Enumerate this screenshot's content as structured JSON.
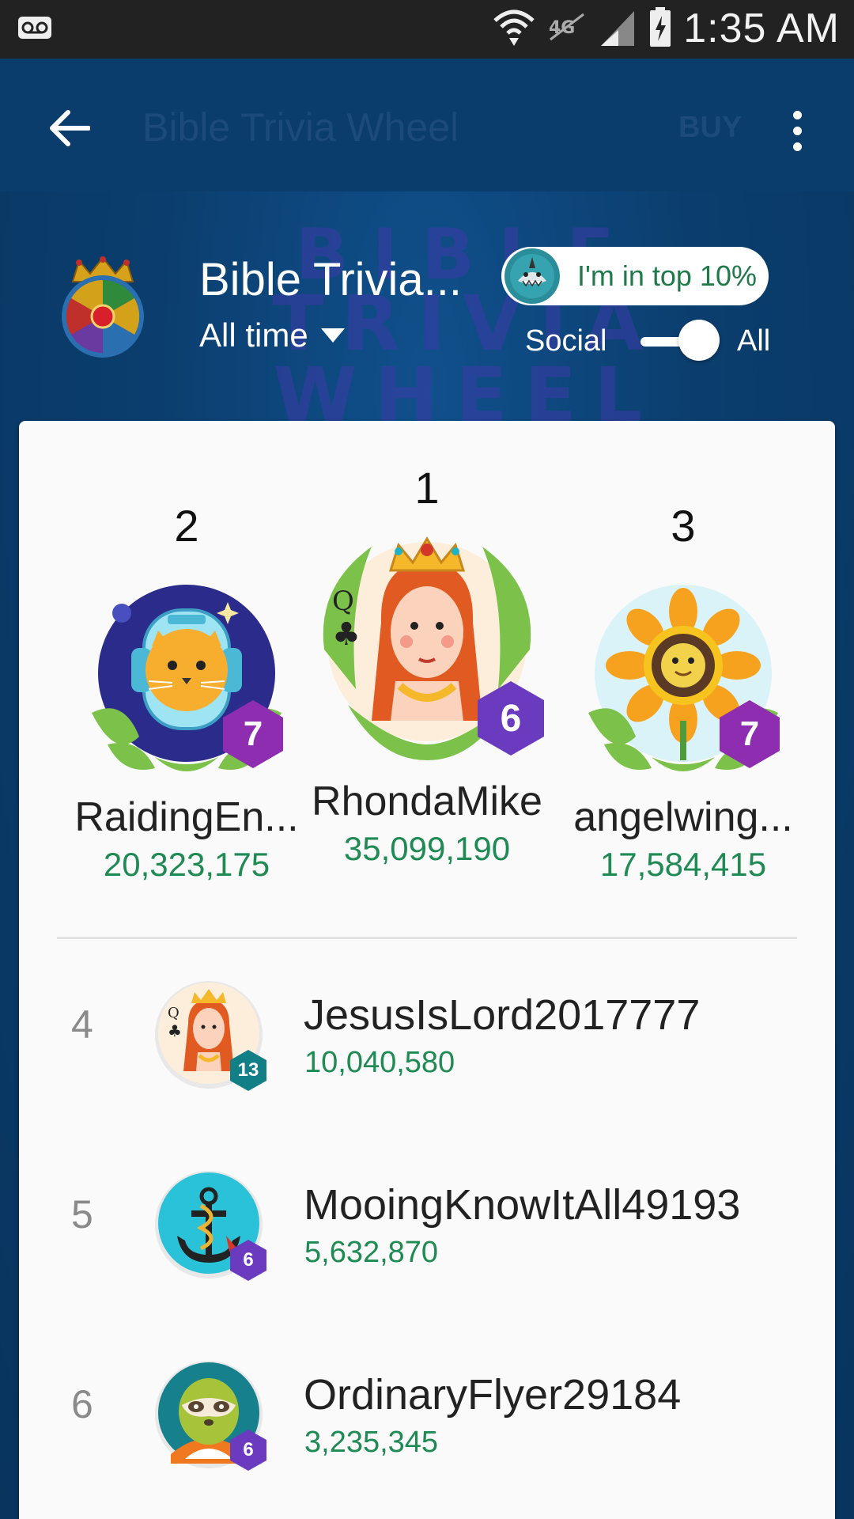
{
  "status_bar": {
    "time": "1:35 AM"
  },
  "app_bar": {
    "title": "Bible Trivia Wheel",
    "buy_label": "BUY"
  },
  "banner": {
    "bg_line1": "BIBLE",
    "bg_line2": "TRIVIA WHEEL",
    "game_name": "Bible Trivia...",
    "period": "All time",
    "badge_text": "I'm in top 10%",
    "toggle_left": "Social",
    "toggle_right": "All",
    "toggle_selected": "All"
  },
  "podium": [
    {
      "rank": "2",
      "name": "RaidingEn...",
      "score": "20,323,175",
      "level": "7",
      "avatar": "astronaut-cat",
      "level_color": "#8e2db0"
    },
    {
      "rank": "1",
      "name": "RhondaMike",
      "score": "35,099,190",
      "level": "6",
      "avatar": "queen-of-clubs",
      "level_color": "#6a3bbf"
    },
    {
      "rank": "3",
      "name": "angelwing...",
      "score": "17,584,415",
      "level": "7",
      "avatar": "sunflower",
      "level_color": "#8e2db0"
    }
  ],
  "list": [
    {
      "rank": "4",
      "name": "JesusIsLord2017777",
      "score": "10,040,580",
      "level": "13",
      "avatar": "queen-of-clubs",
      "level_color": "#127f86"
    },
    {
      "rank": "5",
      "name": "MooingKnowItAll49193",
      "score": "5,632,870",
      "level": "6",
      "avatar": "anchor",
      "level_color": "#6a3bbf"
    },
    {
      "rank": "6",
      "name": "OrdinaryFlyer29184",
      "score": "3,235,345",
      "level": "6",
      "avatar": "sloth",
      "level_color": "#6a3bbf"
    }
  ]
}
